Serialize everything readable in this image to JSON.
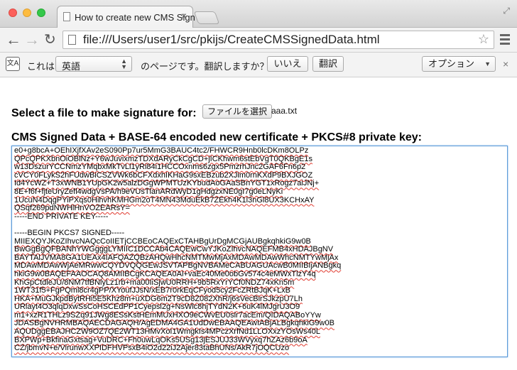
{
  "browser": {
    "tab_title": "How to create new CMS Sign",
    "tab_close": "×",
    "url": "file:///Users/user1/src/pkijs/CreateCMSSignedData.html"
  },
  "translate_bar": {
    "icon_text": "文A",
    "text_prefix": "これは",
    "language": "英語",
    "text_suffix": "のページです。翻訳しますか？",
    "no_button": "いいえ",
    "translate_button": "翻訳",
    "options_button": "オプション",
    "close": "×"
  },
  "page": {
    "file_label": "Select a file to make signature for:",
    "file_button": "ファイルを選択",
    "file_name": "aaa.txt",
    "output_label": "CMS Signed Data + BASE-64 encoded new certificate + PKCS#8 private key:",
    "output_lines": [
      {
        "text": "e0+g8bcA+OEhIXjfXAv2eS090Pp7ur5MmG3BAUC4tc2/FHWCR9Hnb0lcDKm8OLPz",
        "spell": true
      },
      {
        "text": "QPcQPKXbnOiOBlNz+Y6wJuvixmzTDXdARyCkCgCD+jICKhwm6stEbVgT0QKBgE1s",
        "spell": true
      },
      {
        "text": "w13DszurYCCNmzYMqbxMkTvLl1yRi84i1HCCOxnms6zgx5PmzrhJnc2GAF6Fn6p2",
        "spell": true
      },
      {
        "text": "cVCY0FLykS2hFUdwBiCSZVWk6bCFXdxhIKHaG9sxEBzub2XJim0rnKXdP9BXJGOZ",
        "spell": true
      },
      {
        "text": "Id4YcWZ+T3xWNB1YUpGK2w5alzDGgWPMTUzKYbudAoGAaSBnYGT1xRogz7aiJNj+",
        "spell": true
      },
      {
        "text": "8E+f6f+fjteUryZefl4wdgVsPA/h9eVUsTlanARdWyD1gHdgzxNE0gI7g0eLNyKi",
        "spell": true
      },
      {
        "text": "1UcuN4DqgPYiPXqs0HihvhKMHGm2oT4MN43MduEkB7ZEkh4K1l3nGl8UX3KCHxAY",
        "spell": true
      },
      {
        "text": "QSqf269pdNWHlHnVOZEARsY=",
        "spell": true
      },
      {
        "text": "-----END PRIVATE KEY-----",
        "spell": false
      },
      {
        "text": "",
        "spell": false
      },
      {
        "text": "-----BEGIN PKCS7 SIGNED-----",
        "spell": false
      },
      {
        "text": "MIIEXQYJKoZIhvcNAQcCoIIETjCCBEoCAQExCTAHBgUrDgMCGjAUBgkqhkiG9w0B",
        "spell": true
      },
      {
        "text": "BwGgBgQFBANhYWGgggLYMIIC1DCCAb4CAQEwCwYJKoZIhvcNAQEFMB4xHDAJBgNV",
        "spell": true
      },
      {
        "text": "BAYTAlJVMA8GA1UEAx4IAFQAZQBzAHQwHhcNMTMwMjAxMDAwMDAwWhcNMTYwMjAx",
        "spell": true
      },
      {
        "text": "MDAwMDAwWjAeMRwwCQYDVQQGEwJSVTAPBgNVBAMeCABUAGUAcwB0MIIBIjANBgkq",
        "spell": true
      },
      {
        "text": "hkiG9w0BAQEFAAOCAQ8AMIIBCgKCAQEA0Al+vaEc40Me0obGv574c4eMWxTlzY4q",
        "spell": true
      },
      {
        "text": "KhGpCtdleJU/8NM7tfBNlyLz1rb+ma00IiSjwU0RRH+9b5RxYrYCf0NDZ74xKn5m",
        "spell": true
      },
      {
        "text": "1WT31f5+FgPQml8cr4gPP/XYoufJJsN/xEB7r0rkEqCFyod5cy2FcZRtBJqK+LxB",
        "spell": true
      },
      {
        "text": "HKA+MuGJkpdBytRHi5E5Khz8m+uXDG6m2T9cD8Z082XhR/j6sVecBirSJkzpU7Lh",
        "spell": true
      },
      {
        "text": "URlayt4O3qlqDxwSsCoHSCEdPP1Cyepsl2g+NsWlc8hjTYdN2K+6uK4lMJgrU3O9",
        "spell": true
      },
      {
        "text": "m1+xzR1THLz9SZq91JWg8ESsKstHEmMUxHXO9eCWvEU0slr7acEm/QIDAQABoYYw",
        "spell": true
      },
      {
        "text": "JDASBgNVHRMBAQAECDAGAQH/AgEDMA4GA1UdDwEBAAQEAwIABjALBgkqhkiG9w0B",
        "spell": true
      },
      {
        "text": "AQUDggEBAJHCZW9OZ7QE2WT13HMvXoI1WmgkIs4MPczXrfNd1LLOXxzYOsWs40L",
        "spell": true
      },
      {
        "text": "BXPWp+BkfinaGxtsag+VuDRC+Fh0uwLqOKs5USg13jESJUJ33WVyxq7hZAz6b9oA",
        "spell": true
      },
      {
        "text": "CZ/jbmvN+e/VirunwXXPIDFHVPsxB4iO2d22iJ2Ajer83taBhUNs/AkR7jOQCUzo",
        "spell": true
      }
    ]
  }
}
